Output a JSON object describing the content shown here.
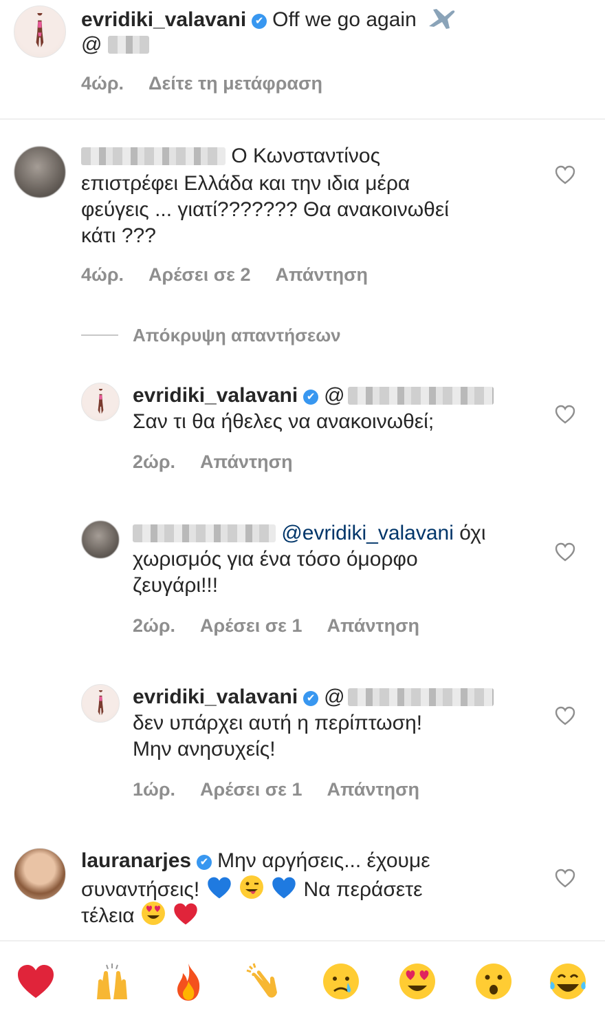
{
  "caption": {
    "username": "evridiki_valavani",
    "text": "Off we go again",
    "emoji": "airplane-icon",
    "mention_prefix": "@",
    "time": "4ώρ.",
    "translate": "Δείτε τη μετάφραση"
  },
  "comments": [
    {
      "text_lines": [
        "Ο Κωνσταντίνος",
        "επιστρέφει Ελλάδα και την ιδια μέρα",
        "φεύγεις ... γιατί??????? Θα ανακοινωθεί",
        "κάτι ???"
      ],
      "time": "4ώρ.",
      "likes": "Αρέσει σε 2",
      "reply": "Απάντηση"
    }
  ],
  "hide_replies": "Απόκρυψη απαντήσεων",
  "replies": [
    {
      "username": "evridiki_valavani",
      "mention_prefix": "@",
      "text_lines": [
        "Σαν τι θα ήθελες να ανακοινωθεί;"
      ],
      "time": "2ώρ.",
      "reply": "Απάντηση"
    },
    {
      "mention": "@evridiki_valavani",
      "text_first": "όχι",
      "text_lines": [
        "χωρισμός για ένα τόσο όμορφο",
        "ζευγάρι!!!"
      ],
      "time": "2ώρ.",
      "likes": "Αρέσει σε 1",
      "reply": "Απάντηση"
    },
    {
      "username": "evridiki_valavani",
      "mention_prefix": "@",
      "text_lines": [
        "δεν υπάρχει αυτή η περίπτωση!",
        "Μην ανησυχείς!"
      ],
      "time": "1ώρ.",
      "likes": "Αρέσει σε 1",
      "reply": "Απάντηση"
    }
  ],
  "last_comment": {
    "username": "lauranarjes",
    "text_first": "Μην αργήσεις... έχουμε",
    "line2_a": "συναντήσεις!",
    "line2_b": "Να περάσετε",
    "line3": "τέλεια"
  },
  "emoji_bar": [
    "❤️",
    "🙌",
    "🔥",
    "👏",
    "😢",
    "😍",
    "😮",
    "😂"
  ],
  "colors": {
    "meta_gray": "#8e8e8e",
    "verified_blue": "#3897f0",
    "text": "#262626"
  }
}
